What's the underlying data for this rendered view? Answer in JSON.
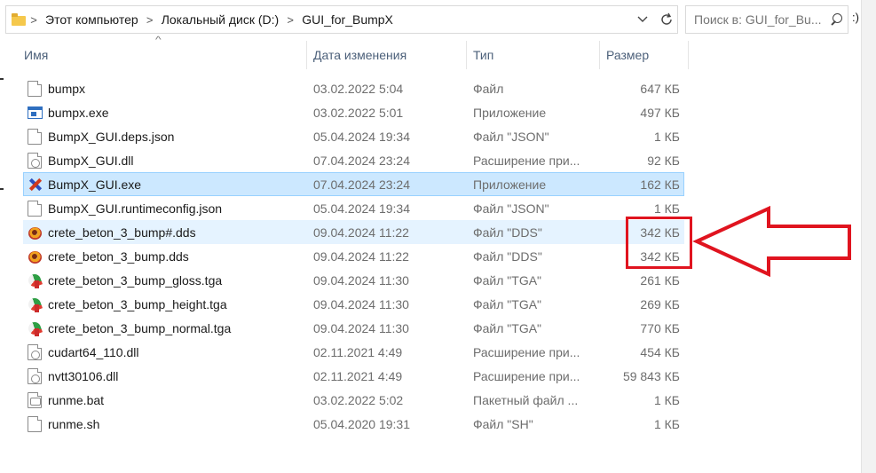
{
  "address": {
    "crumbs": [
      "Этот компьютер",
      "Локальный диск (D:)",
      "GUI_for_BumpX"
    ],
    "separator": ">",
    "dropdown_icon": "chevron-down-icon",
    "refresh_icon": "refresh-icon"
  },
  "search": {
    "placeholder": "Поиск в: GUI_for_Bu...",
    "icon": "search-icon"
  },
  "right_panel": {
    "text": ":)"
  },
  "columns": {
    "name": "Имя",
    "date": "Дата изменения",
    "type": "Тип",
    "size": "Размер",
    "sort_indicator": "^"
  },
  "files": [
    {
      "name": "bumpx",
      "date": "03.02.2022 5:04",
      "type": "Файл",
      "size": "647 КБ",
      "icon": "file-icon"
    },
    {
      "name": "bumpx.exe",
      "date": "03.02.2022 5:01",
      "type": "Приложение",
      "size": "497 КБ",
      "icon": "exe-icon"
    },
    {
      "name": "BumpX_GUI.deps.json",
      "date": "05.04.2024 19:34",
      "type": "Файл \"JSON\"",
      "size": "1 КБ",
      "icon": "file-icon"
    },
    {
      "name": "BumpX_GUI.dll",
      "date": "07.04.2024 23:24",
      "type": "Расширение при...",
      "size": "92 КБ",
      "icon": "dll-icon"
    },
    {
      "name": "BumpX_GUI.exe",
      "date": "07.04.2024 23:24",
      "type": "Приложение",
      "size": "162 КБ",
      "icon": "bumpx-app-icon",
      "selected": true
    },
    {
      "name": "BumpX_GUI.runtimeconfig.json",
      "date": "05.04.2024 19:34",
      "type": "Файл \"JSON\"",
      "size": "1 КБ",
      "icon": "file-icon"
    },
    {
      "name": "crete_beton_3_bump#.dds",
      "date": "09.04.2024 11:22",
      "type": "Файл \"DDS\"",
      "size": "342 КБ",
      "icon": "dds-icon",
      "hover": true
    },
    {
      "name": "crete_beton_3_bump.dds",
      "date": "09.04.2024 11:22",
      "type": "Файл \"DDS\"",
      "size": "342 КБ",
      "icon": "dds-icon"
    },
    {
      "name": "crete_beton_3_bump_gloss.tga",
      "date": "09.04.2024 11:30",
      "type": "Файл \"TGA\"",
      "size": "261 КБ",
      "icon": "tga-icon"
    },
    {
      "name": "crete_beton_3_bump_height.tga",
      "date": "09.04.2024 11:30",
      "type": "Файл \"TGA\"",
      "size": "269 КБ",
      "icon": "tga-icon"
    },
    {
      "name": "crete_beton_3_bump_normal.tga",
      "date": "09.04.2024 11:30",
      "type": "Файл \"TGA\"",
      "size": "770 КБ",
      "icon": "tga-icon"
    },
    {
      "name": "cudart64_110.dll",
      "date": "02.11.2021 4:49",
      "type": "Расширение при...",
      "size": "454 КБ",
      "icon": "dll-icon"
    },
    {
      "name": "nvtt30106.dll",
      "date": "02.11.2021 4:49",
      "type": "Расширение при...",
      "size": "59 843 КБ",
      "icon": "dll-icon"
    },
    {
      "name": "runme.bat",
      "date": "03.02.2022 5:02",
      "type": "Пакетный файл ...",
      "size": "1 КБ",
      "icon": "bat-icon"
    },
    {
      "name": "runme.sh",
      "date": "05.04.2020 19:31",
      "type": "Файл \"SH\"",
      "size": "1 КБ",
      "icon": "file-icon"
    }
  ],
  "annotation": {
    "color": "#e0141f",
    "shape": "red rectangle with left-pointing arrow"
  },
  "colors": {
    "selected_bg": "#cce8ff",
    "hover_bg": "#e5f3ff",
    "header_text": "#4c607a",
    "muted_text": "#6d6d6d"
  }
}
